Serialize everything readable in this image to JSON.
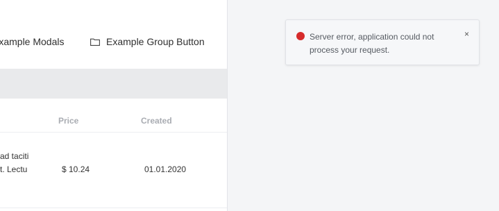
{
  "nav": {
    "modals_label": "Example Modals",
    "group_button_label": "Example Group Button",
    "group_button_icon": "folder-icon"
  },
  "table": {
    "columns": [
      "Price",
      "Created"
    ],
    "rows": [
      {
        "description_lines": [
          "ad taciti",
          "t. Lectu"
        ],
        "price": "$ 10.24",
        "created": "01.01.2020"
      }
    ]
  },
  "toast": {
    "message": "Server error, application could not process your request.",
    "close_label": "×",
    "status_color": "#d62b2b",
    "icon": "error-dot-icon"
  }
}
